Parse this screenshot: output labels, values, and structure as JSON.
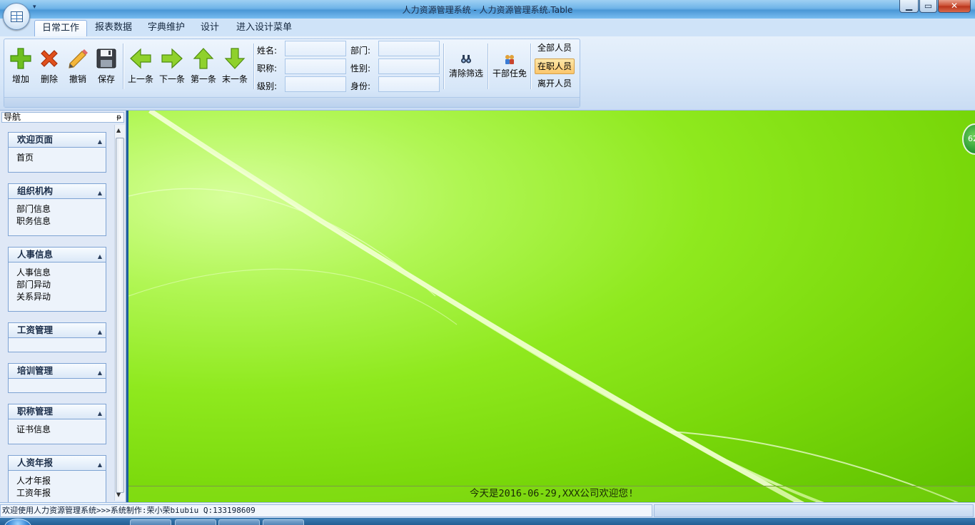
{
  "window": {
    "title": "人力资源管理系统 - 人力资源管理系统.Table",
    "qat_glyph": "▾",
    "min_glyph": "▁",
    "max_glyph": "▭",
    "close_glyph": "✕"
  },
  "ribbon": {
    "tabs": [
      "日常工作",
      "报表数据",
      "字典维护",
      "设计",
      "进入设计菜单"
    ],
    "active_tab": 0,
    "buttons": {
      "add": "增加",
      "delete": "删除",
      "undo": "撤销",
      "save": "保存",
      "prev": "上一条",
      "next": "下一条",
      "first": "第一条",
      "last": "末一条",
      "clear_filter": "清除筛选",
      "cadre": "干部任免"
    },
    "filters": {
      "name_label": "姓名:",
      "title_label": "职称:",
      "level_label": "级别:",
      "dept_label": "部门:",
      "gender_label": "性别:",
      "identity_label": "身份:",
      "name_value": "",
      "title_value": "",
      "level_value": "",
      "dept_value": "",
      "gender_value": "",
      "identity_value": ""
    },
    "staff_filter": {
      "all": "全部人员",
      "active": "在职人员",
      "left": "离开人员",
      "selected": "在职人员"
    }
  },
  "nav": {
    "title": "导航",
    "pin_glyph": "ᵽ",
    "groups": [
      {
        "title": "欢迎页面",
        "items": [
          "首页"
        ]
      },
      {
        "title": "组织机构",
        "items": [
          "部门信息",
          "职务信息"
        ]
      },
      {
        "title": "人事信息",
        "items": [
          "人事信息",
          "部门异动",
          "关系异动"
        ]
      },
      {
        "title": "工资管理",
        "items": []
      },
      {
        "title": "培训管理",
        "items": []
      },
      {
        "title": "职称管理",
        "items": [
          "证书信息"
        ]
      },
      {
        "title": "人资年报",
        "items": [
          "人才年报",
          "工资年报"
        ]
      }
    ]
  },
  "main": {
    "welcome": "今天是2016-06-29,XXX公司欢迎您!",
    "badge": "62"
  },
  "status": {
    "left": "欢迎使用人力资源管理系统>>>系统制作:荣小荣biubiu  Q:133198609",
    "right": ""
  },
  "colors": {
    "ribbon_bg": "#d9e8f9",
    "desktop_green": "#79d80a",
    "nav_bg": "#dfe8f6"
  }
}
